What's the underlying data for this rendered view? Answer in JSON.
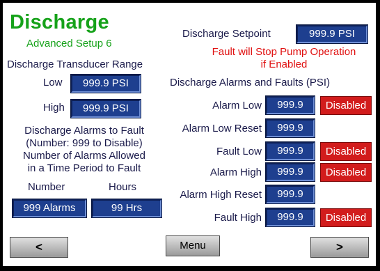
{
  "header": {
    "title": "Discharge",
    "subtitle": "Advanced Setup 6",
    "setpoint_label": "Discharge Setpoint",
    "setpoint_value": "999.9 PSI",
    "fault_note_line1": "Fault will Stop Pump Operation",
    "fault_note_line2": "if Enabled"
  },
  "transducer": {
    "heading": "Discharge Transducer Range",
    "low_label": "Low",
    "low_value": "999.9 PSI",
    "high_label": "High",
    "high_value": "999.9 PSI"
  },
  "alarms_to_fault": {
    "line1": "Discharge Alarms to Fault",
    "line2": "(Number: 999 to Disable)",
    "line3": "Number of Alarms Allowed",
    "line4": "in a Time Period to Fault",
    "number_label": "Number",
    "hours_label": "Hours",
    "number_value": "999 Alarms",
    "hours_value": "99 Hrs"
  },
  "alarms_faults": {
    "heading": "Discharge Alarms and Faults (PSI)",
    "rows": [
      {
        "label": "Alarm Low",
        "value": "999.9",
        "status": "Disabled"
      },
      {
        "label": "Alarm Low Reset",
        "value": "999.9",
        "status": ""
      },
      {
        "label": "Fault Low",
        "value": "999.9",
        "status": "Disabled"
      },
      {
        "label": "Alarm High",
        "value": "999.9",
        "status": "Disabled"
      },
      {
        "label": "Alarm High Reset",
        "value": "999.9",
        "status": ""
      },
      {
        "label": "Fault High",
        "value": "999.9",
        "status": "Disabled"
      }
    ]
  },
  "nav": {
    "prev": "<",
    "menu": "Menu",
    "next": ">"
  },
  "colors": {
    "title_green": "#16a21a",
    "value_blue": "#1e3f8f",
    "disabled_red": "#d21c1c",
    "note_red": "#e01010"
  }
}
